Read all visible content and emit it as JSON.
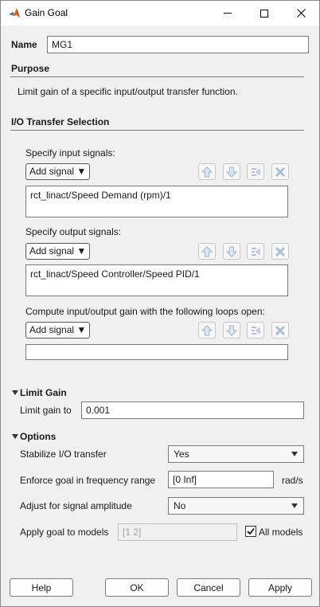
{
  "window": {
    "title": "Gain Goal"
  },
  "name_row": {
    "label": "Name",
    "value": "MG1"
  },
  "purpose": {
    "title": "Purpose",
    "text": "Limit gain of a specific input/output transfer function."
  },
  "io": {
    "title": "I/O Transfer Selection",
    "input": {
      "label": "Specify input signals:",
      "add_label": "Add signal ▼",
      "items": [
        "rct_linact/Speed Demand (rpm)/1"
      ]
    },
    "output": {
      "label": "Specify output signals:",
      "add_label": "Add signal ▼",
      "items": [
        "rct_linact/Speed Controller/Speed PID/1"
      ]
    },
    "loops": {
      "label": "Compute input/output gain with the following loops open:",
      "add_label": "Add signal ▼",
      "items": [
        ""
      ]
    }
  },
  "limit_gain": {
    "title": "Limit Gain",
    "label": "Limit gain to",
    "value": "0.001"
  },
  "options": {
    "title": "Options",
    "stabilize": {
      "label": "Stabilize I/O transfer",
      "value": "Yes"
    },
    "freq_range": {
      "label": "Enforce goal in frequency range",
      "value": "[0 Inf]",
      "unit": "rad/s"
    },
    "amplitude": {
      "label": "Adjust for signal amplitude",
      "value": "No"
    },
    "models": {
      "label": "Apply goal to models",
      "placeholder": "[1 2]",
      "checkbox_label": "All models",
      "checked": true
    }
  },
  "buttons": {
    "help": "Help",
    "ok": "OK",
    "cancel": "Cancel",
    "apply": "Apply"
  },
  "colors": {
    "accent_icon": "#4a86c5",
    "disabled_text": "#a0a0a0"
  }
}
